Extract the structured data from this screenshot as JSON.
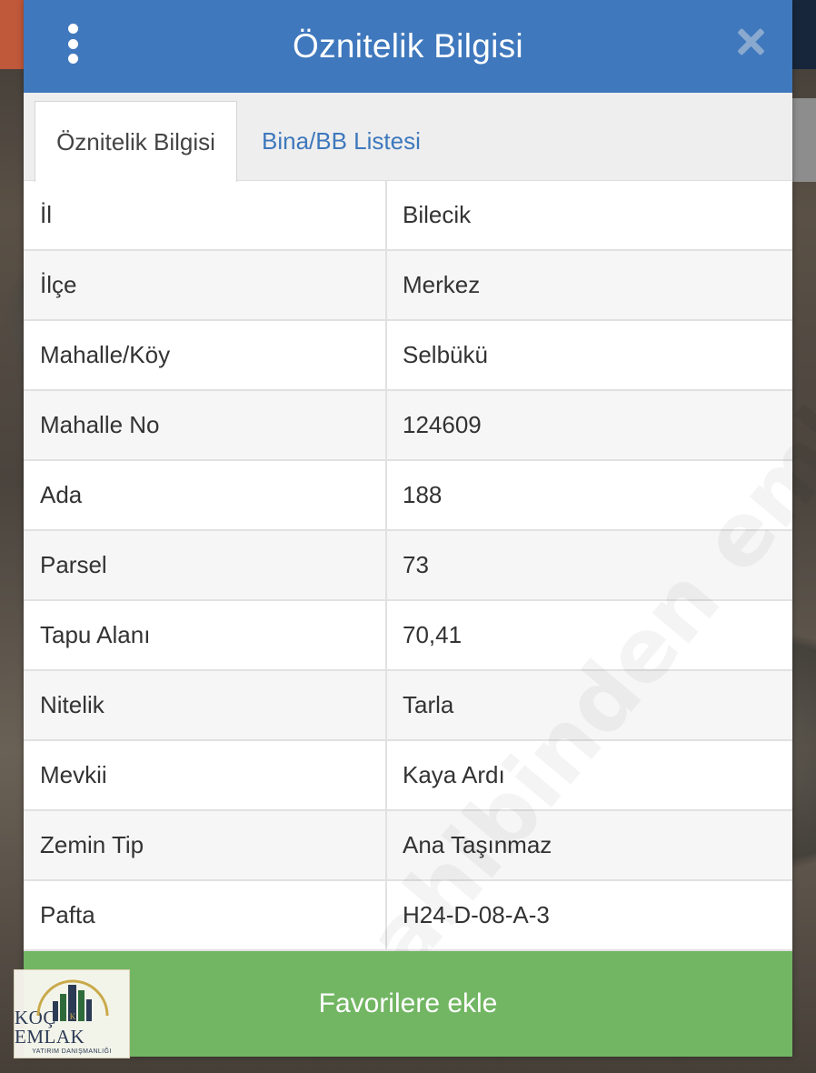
{
  "header": {
    "title": "Öznitelik Bilgisi"
  },
  "tabs": [
    {
      "label": "Öznitelik Bilgisi",
      "active": true
    },
    {
      "label": "Bina/BB Listesi",
      "active": false
    }
  ],
  "rows": [
    {
      "label": "İl",
      "value": "Bilecik"
    },
    {
      "label": "İlçe",
      "value": "Merkez"
    },
    {
      "label": "Mahalle/Köy",
      "value": "Selbükü"
    },
    {
      "label": "Mahalle No",
      "value": "124609"
    },
    {
      "label": "Ada",
      "value": "188"
    },
    {
      "label": "Parsel",
      "value": "73"
    },
    {
      "label": "Tapu Alanı",
      "value": "70,41"
    },
    {
      "label": "Nitelik",
      "value": "Tarla"
    },
    {
      "label": "Mevkii",
      "value": "Kaya Ardı"
    },
    {
      "label": "Zemin Tip",
      "value": "Ana Taşınmaz"
    },
    {
      "label": "Pafta",
      "value": "H24-D-08-A-3"
    }
  ],
  "actions": {
    "favorite_label": "Favorilere ekle"
  },
  "watermark": "sahibinden emlakjet.com",
  "logo": {
    "name": "KOÇ EMLAK",
    "subtitle": "YATIRIM DANIŞMANLIĞI"
  },
  "colors": {
    "header_bg": "#3f78bd",
    "tab_link": "#3d78bd",
    "favorite_bg": "#72b663"
  },
  "icons": {
    "menu": "more-vertical-icon",
    "close": "close-icon"
  }
}
